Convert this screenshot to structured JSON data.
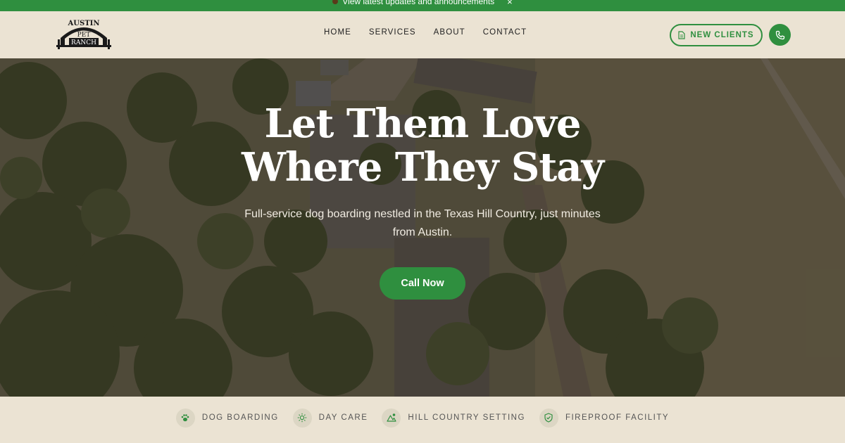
{
  "announcement": {
    "text": "View latest updates and announcements",
    "close_icon": "×"
  },
  "logo": {
    "line1": "AUSTIN",
    "line2": "PET",
    "line3": "RANCH"
  },
  "nav": {
    "items": [
      {
        "label": "HOME"
      },
      {
        "label": "SERVICES"
      },
      {
        "label": "ABOUT"
      },
      {
        "label": "CONTACT"
      }
    ]
  },
  "header": {
    "new_clients_label": "NEW CLIENTS",
    "new_clients_icon": "document-icon",
    "phone_icon": "phone-icon"
  },
  "hero": {
    "title_line1": "Let Them Love",
    "title_line2": "Where They Stay",
    "subtitle": "Full-service dog boarding nestled in the Texas Hill Country, just minutes from Austin.",
    "cta_label": "Call Now"
  },
  "features": [
    {
      "label": "DOG BOARDING",
      "icon": "paw-icon"
    },
    {
      "label": "DAY CARE",
      "icon": "sun-icon"
    },
    {
      "label": "HILL COUNTRY SETTING",
      "icon": "mountain-icon"
    },
    {
      "label": "FIREPROOF FACILITY",
      "icon": "shield-check-icon"
    }
  ],
  "colors": {
    "brand_green": "#2f8f3f",
    "cream": "#ebe3d3",
    "icon_bg": "#dcd6c4"
  }
}
